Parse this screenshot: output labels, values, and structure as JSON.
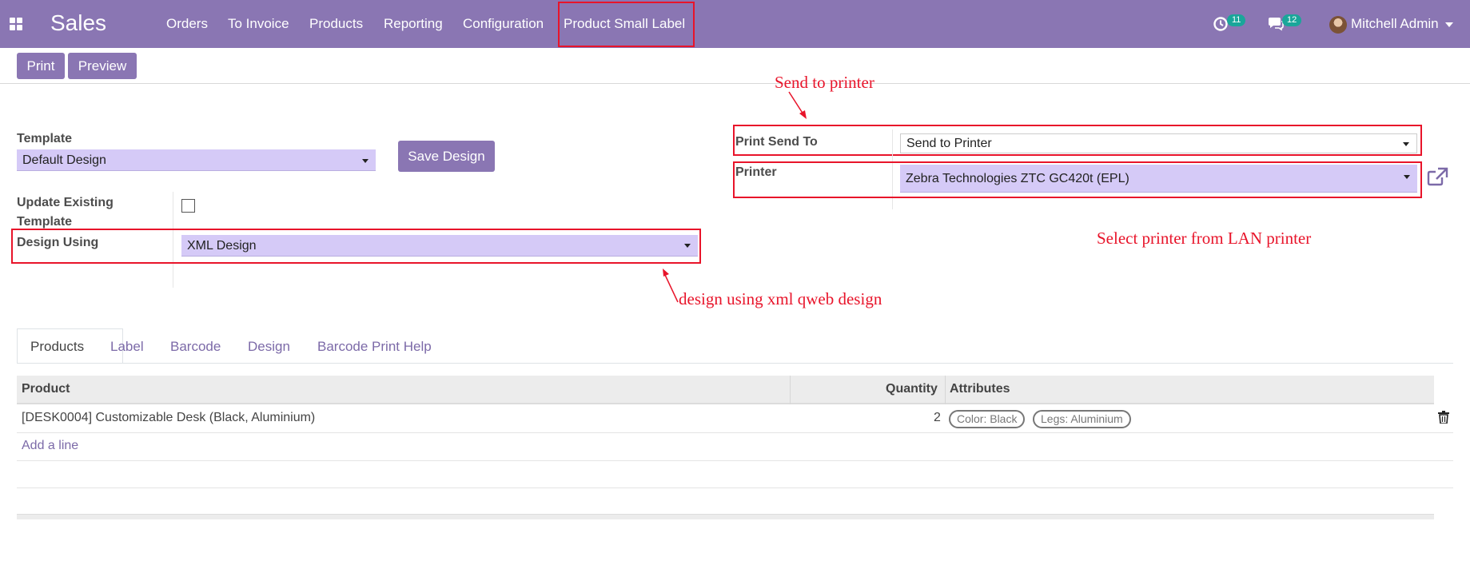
{
  "navbar": {
    "app_title": "Sales",
    "menu": [
      "Orders",
      "To Invoice",
      "Products",
      "Reporting",
      "Configuration",
      "Product Small Label"
    ],
    "activity_count": "11",
    "messages_count": "12",
    "user_name": "Mitchell Admin"
  },
  "control": {
    "print_label": "Print",
    "preview_label": "Preview"
  },
  "form": {
    "template_label": "Template",
    "template_value": "Default Design",
    "save_design_label": "Save Design",
    "update_existing_label_line1": "Update Existing",
    "update_existing_label_line2": "Template",
    "design_using_label": "Design Using",
    "design_using_value": "XML Design",
    "print_send_to_label": "Print Send To",
    "print_send_to_value": "Send to Printer",
    "printer_label": "Printer",
    "printer_value": "Zebra Technologies ZTC GC420t (EPL)"
  },
  "annotations": {
    "send_to_printer": "Send to printer",
    "select_printer": "Select printer from LAN printer",
    "design_using_xml": "design using xml qweb design"
  },
  "tabs": [
    "Products",
    "Label",
    "Barcode",
    "Design",
    "Barcode Print Help"
  ],
  "table": {
    "headers": {
      "product": "Product",
      "quantity": "Quantity",
      "attributes": "Attributes"
    },
    "rows": [
      {
        "product": "[DESK0004] Customizable Desk (Black, Aluminium)",
        "quantity": "2",
        "attributes": [
          "Color: Black",
          "Legs: Aluminium"
        ]
      }
    ],
    "add_line": "Add a line"
  },
  "colors": {
    "brand": "#8a76b3",
    "annotation_red": "#e8142a",
    "field_bg": "#d5caf7",
    "badge": "#1aa69a"
  }
}
